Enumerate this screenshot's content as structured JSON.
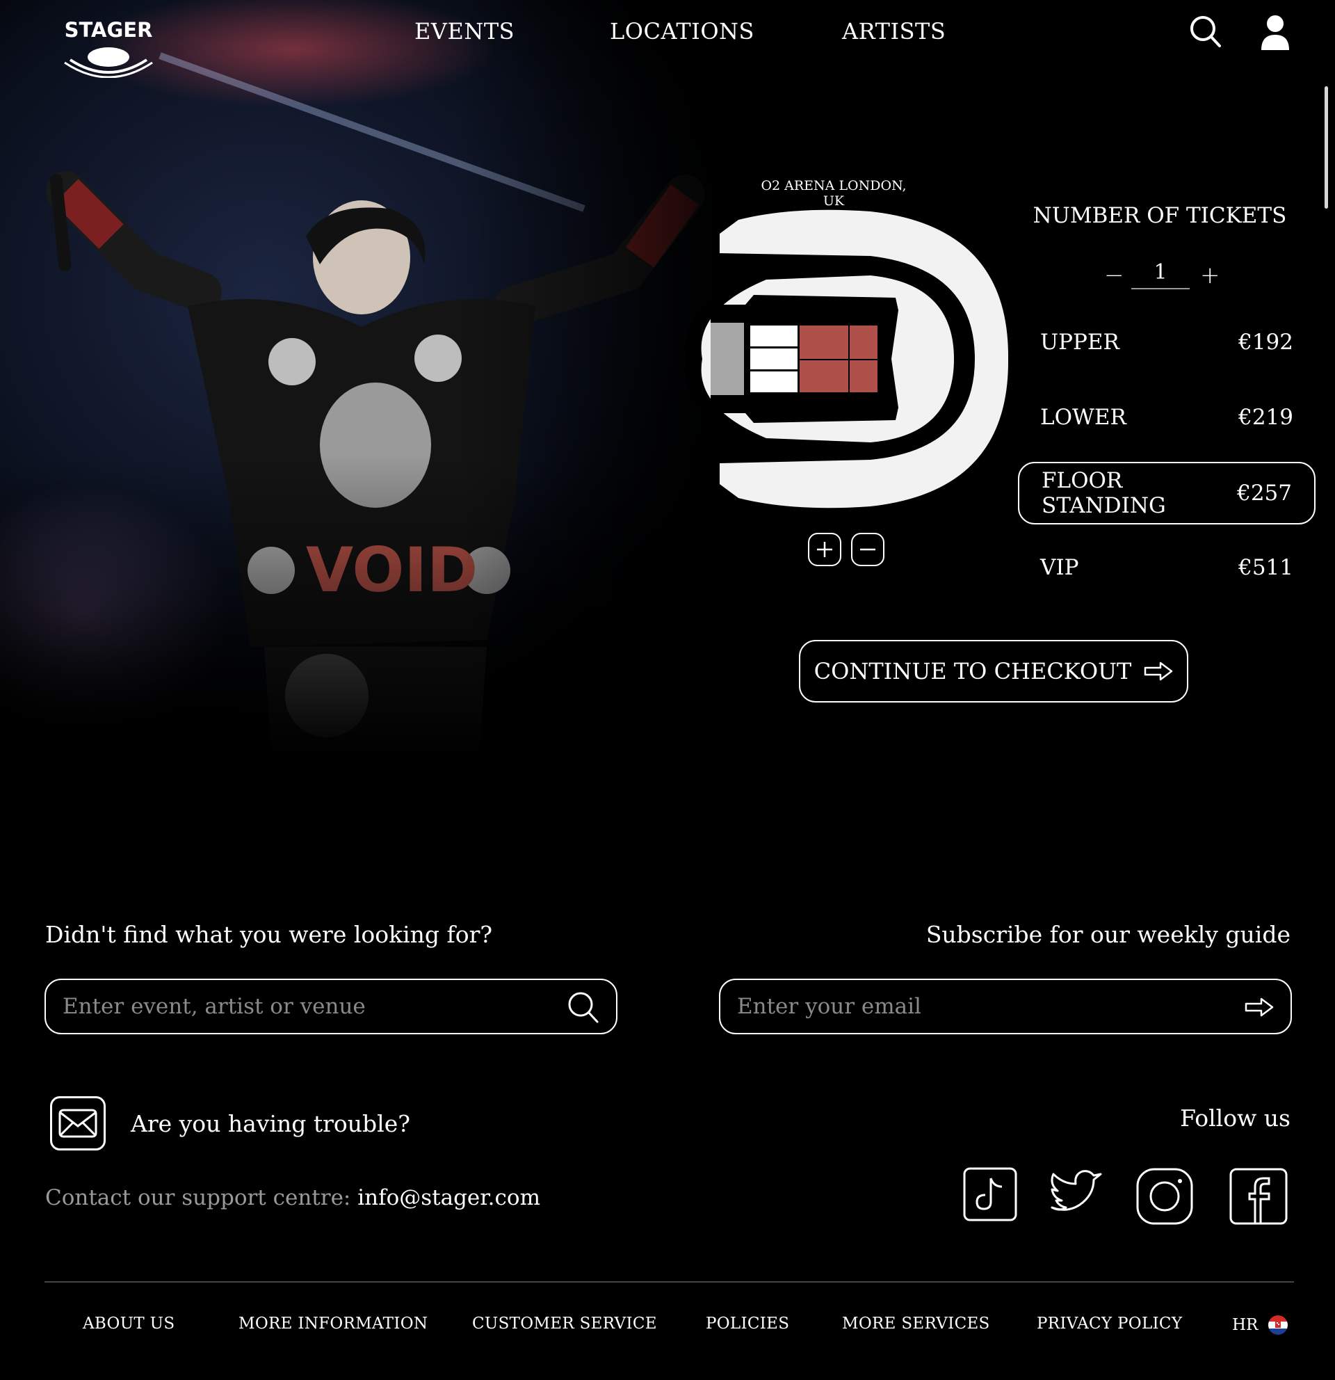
{
  "brand": {
    "logo_text": "STAGER"
  },
  "nav": {
    "links": [
      "EVENTS",
      "LOCATIONS",
      "ARTISTS"
    ],
    "search_icon": "search-icon",
    "profile_icon": "user-icon"
  },
  "hero": {
    "image": "concert-performer-photo"
  },
  "venue": {
    "label": "O2 ARENA LONDON, UK",
    "zoom_in_icon": "plus-icon",
    "zoom_out_icon": "minus-icon",
    "colors": {
      "seating": "#f2f2f2",
      "selected": "#b0504b",
      "stage": "#a6a6a6",
      "floor": "#ffffff"
    }
  },
  "tickets": {
    "title": "NUMBER OF TICKETS",
    "quantity": "1",
    "minus": "−",
    "plus": "+",
    "tiers": [
      {
        "name": "UPPER",
        "price": "€192"
      },
      {
        "name": "LOWER",
        "price": "€219"
      },
      {
        "name": "FLOOR STANDING",
        "price": "€257",
        "selected": true
      },
      {
        "name": "VIP",
        "price": "€511"
      }
    ]
  },
  "checkout": {
    "label": "CONTINUE TO CHECKOUT",
    "icon": "arrow-right-icon"
  },
  "footer": {
    "search_heading": "Didn't find what you were looking for?",
    "search_placeholder": "Enter event, artist or venue",
    "subscribe_heading": "Subscribe for our weekly guide",
    "email_placeholder": "Enter your email",
    "trouble": "Are you having trouble?",
    "contact_prefix": "Contact our support centre: ",
    "contact_email": "info@stager.com",
    "follow": "Follow us",
    "socials": [
      "tiktok-icon",
      "twitter-icon",
      "instagram-icon",
      "facebook-icon"
    ],
    "links": [
      "ABOUT US",
      "MORE INFORMATION",
      "CUSTOMER SERVICE",
      "POLICIES",
      "MORE SERVICES",
      "PRIVACY POLICY"
    ],
    "language": "HR"
  }
}
